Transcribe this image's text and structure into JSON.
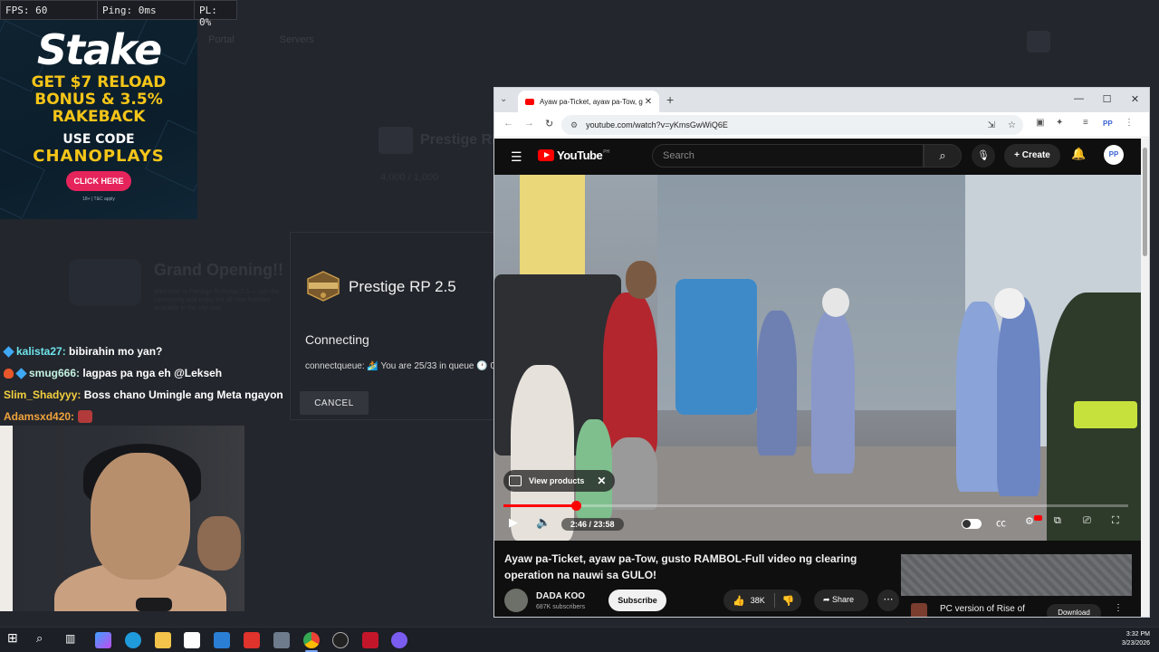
{
  "perf": {
    "fps": "FPS: 60",
    "ping": "Ping: 0ms",
    "pl": "PL: 0%"
  },
  "background_app": {
    "nav": [
      "Portal",
      "Servers"
    ],
    "server_name": "Prestige RP",
    "server_sub": "4,000 / 1,000",
    "headline": "Grand Opening!!",
    "headline_sub": "Welcome to Prestige Roleplay 2.5 — join the community and enjoy the all new features available in the city now."
  },
  "ad": {
    "brand": "Stake",
    "line1": "GET $7 RELOAD",
    "line2": "BONUS & 3.5%",
    "line3": "RAKEBACK",
    "use_code": "USE CODE",
    "code": "CHANOPLAYS",
    "cta": "CLICK HERE",
    "fine": "18+ | T&C apply"
  },
  "chat": [
    {
      "user": "kalista27:",
      "message": "bibirahin mo yan?"
    },
    {
      "user": "smug666:",
      "message": "lagpas pa nga eh @Lekseh"
    },
    {
      "user": "Slim_Shadyyy:",
      "message": "Boss chano Umingle ang Meta ngayon"
    },
    {
      "user": "Adamsxd420:",
      "message": ""
    }
  ],
  "dialog": {
    "server_title": "Prestige RP 2.5",
    "status": "Connecting",
    "queue_text": "connectqueue: 🏄 You are 25/33 in queue 🕐 0",
    "cancel_label": "CANCEL"
  },
  "browser": {
    "tab_title": "Ayaw pa-Ticket, ayaw pa-Tow, g",
    "url": "youtube.com/watch?v=yKmsGwWiQ6E",
    "controls": {
      "minimize": "—",
      "maximize": "☐",
      "close": "✕"
    }
  },
  "youtube": {
    "logo_text": "YouTube",
    "region": "PH",
    "search_placeholder": "Search",
    "create_label": "Create",
    "avatar_label": "PP",
    "view_products": "View products",
    "time": "2:46 / 23:58",
    "progress": 0.116,
    "video_title": "Ayaw pa-Ticket, ayaw pa-Tow, gusto RAMBOL-Full video ng clearing operation na nauwi sa GULO!",
    "channel": "DADA KOO",
    "subscribers": "687K subscribers",
    "subscribe": "Subscribe",
    "likes": "38K",
    "share": "Share",
    "side_ad_title": "PC version of Rise of",
    "side_ad_cta": "Download"
  },
  "taskbar": {
    "time": "3:32 PM",
    "date": "3/23/2026"
  },
  "colors": {
    "yt_red": "#ff0000",
    "accent_gold": "#f5c518",
    "cta_pink": "#e6245c"
  }
}
